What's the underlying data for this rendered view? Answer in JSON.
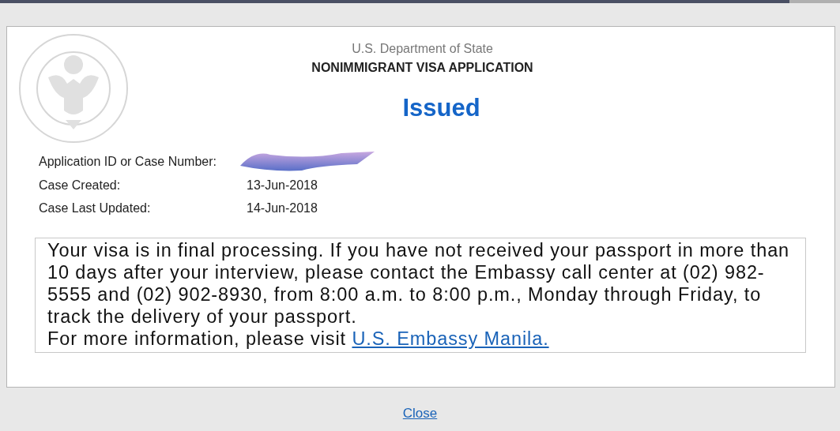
{
  "header": {
    "agency": "U.S. Department of State",
    "form_title": "NONIMMIGRANT VISA APPLICATION"
  },
  "status": "Issued",
  "fields": [
    {
      "label": "Application ID or Case Number:",
      "redacted": true
    },
    {
      "label": "Case Created:",
      "value": "13-Jun-2018"
    },
    {
      "label": "Case Last Updated:",
      "value": "14-Jun-2018"
    }
  ],
  "message": {
    "text": "Your visa is in final processing. If you have not received your passport in more than 10 days after your interview, please contact the Embassy call center at (02) 982-5555 and (02) 902-8930, from 8:00 a.m. to 8:00 p.m., Monday through Friday, to track the delivery of your passport.",
    "more_info": "For more information, please visit",
    "link": "U.S. Embassy Manila."
  },
  "close_link": "Close"
}
